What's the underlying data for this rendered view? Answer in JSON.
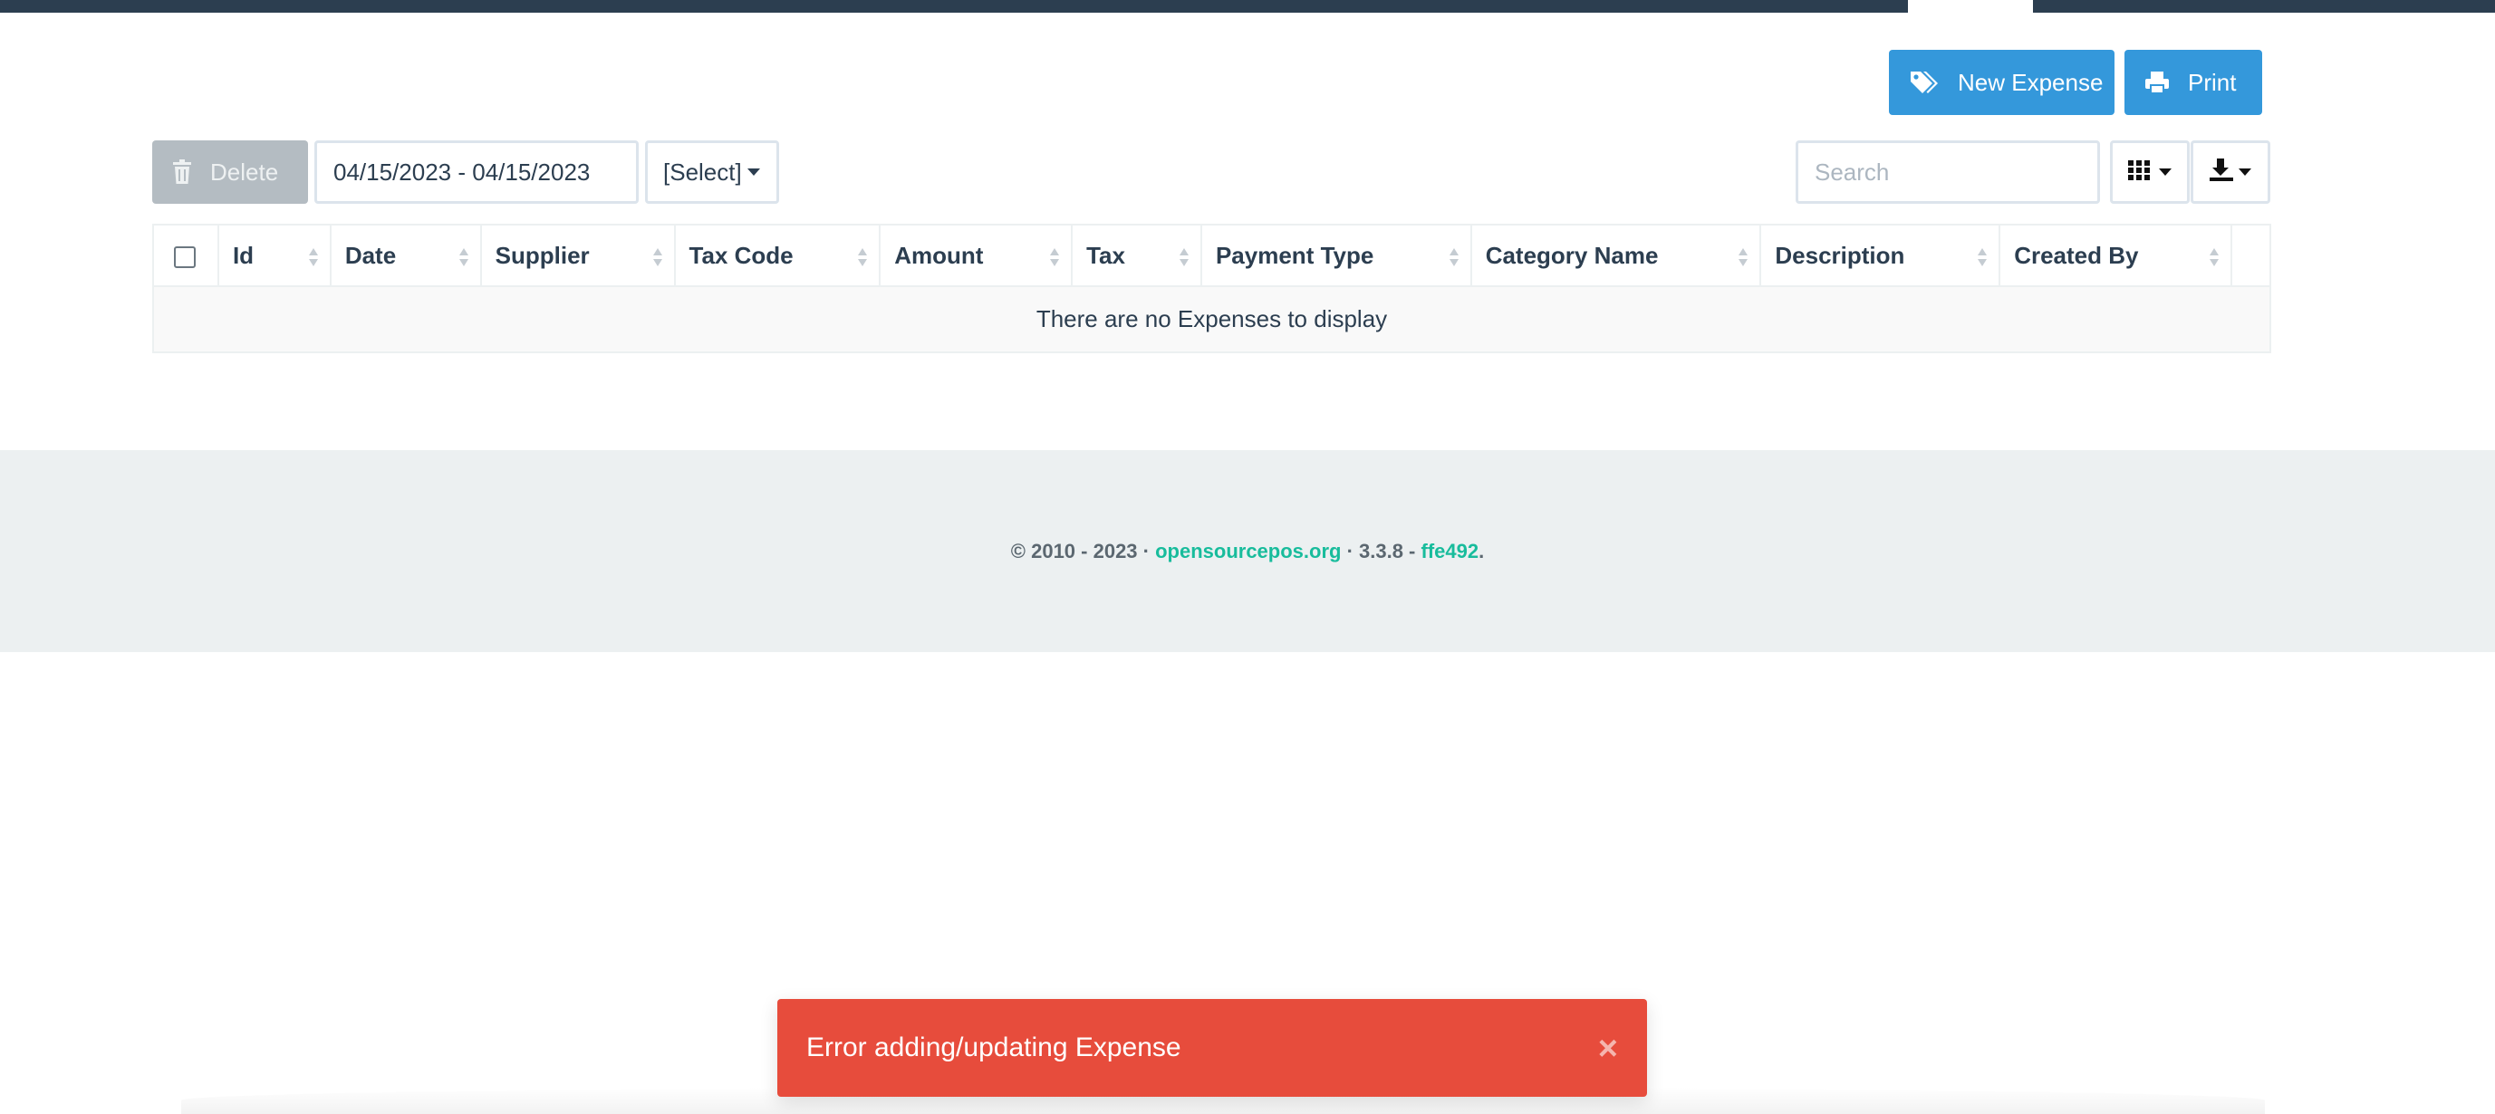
{
  "toolbar": {
    "new_expense_label": "New Expense",
    "print_label": "Print",
    "delete_label": "Delete",
    "date_range_value": "04/15/2023 - 04/15/2023",
    "select_label": "[Select]",
    "search_placeholder": "Search"
  },
  "table": {
    "columns": [
      "Id",
      "Date",
      "Supplier",
      "Tax Code",
      "Amount",
      "Tax",
      "Payment Type",
      "Category Name",
      "Description",
      "Created By"
    ],
    "empty_message": "There are no Expenses to display"
  },
  "footer": {
    "copyright": "© 2010 - 2023 · ",
    "site_link": "opensourcepos.org",
    "version": " · 3.3.8 - ",
    "commit_link": "ffe492",
    "end": "."
  },
  "toast": {
    "message": "Error adding/updating Expense",
    "close": "×",
    "color": "#e74c3c"
  },
  "colors": {
    "primary": "#3498db",
    "navbar": "#2c3e50",
    "link": "#18bc9c",
    "disabled": "#b4bcc2"
  }
}
